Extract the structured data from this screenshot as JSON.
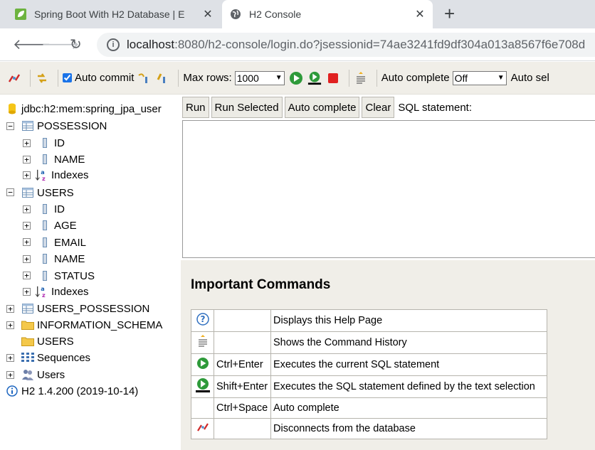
{
  "browser": {
    "tabs": [
      {
        "title": "Spring Boot With H2 Database | E",
        "close": "✕"
      },
      {
        "title": "H2 Console",
        "close": "✕"
      }
    ],
    "new_tab": "+",
    "url_host": "localhost",
    "url_rest": ":8080/h2-console/login.do?jsessionid=74ae3241fd9df304a013a8567f6e708d"
  },
  "toolbar": {
    "auto_commit_label": "Auto commit",
    "max_rows_label": "Max rows:",
    "max_rows_value": "1000",
    "auto_complete_label": "Auto complete",
    "auto_complete_value": "Off",
    "auto_select_label": "Auto sel"
  },
  "tree": {
    "connection": "jdbc:h2:mem:spring_jpa_user",
    "possession": {
      "name": "POSSESSION",
      "cols": [
        "ID",
        "NAME"
      ],
      "indexes": "Indexes"
    },
    "users": {
      "name": "USERS",
      "cols": [
        "ID",
        "AGE",
        "EMAIL",
        "NAME",
        "STATUS"
      ],
      "indexes": "Indexes"
    },
    "users_possession": "USERS_POSSESSION",
    "information_schema": "INFORMATION_SCHEMA",
    "users_folder": "USERS",
    "sequences": "Sequences",
    "users_node": "Users",
    "version": "H2 1.4.200 (2019-10-14)"
  },
  "query": {
    "run": "Run",
    "run_selected": "Run Selected",
    "auto_complete": "Auto complete",
    "clear": "Clear",
    "sql_label": "SQL statement:"
  },
  "help": {
    "title": "Important Commands",
    "rows": [
      {
        "keys": "",
        "desc": "Displays this Help Page"
      },
      {
        "keys": "",
        "desc": "Shows the Command History"
      },
      {
        "keys": "Ctrl+Enter",
        "desc": "Executes the current SQL statement"
      },
      {
        "keys": "Shift+Enter",
        "desc": "Executes the SQL statement defined by the text selection"
      },
      {
        "keys": "Ctrl+Space",
        "desc": "Auto complete"
      },
      {
        "keys": "",
        "desc": "Disconnects from the database"
      }
    ]
  },
  "colors": {
    "toolbar_bg": "#f0eee8",
    "run_green": "#2e9a3a",
    "stop_red": "#e02020",
    "folder": "#f4c84a"
  }
}
